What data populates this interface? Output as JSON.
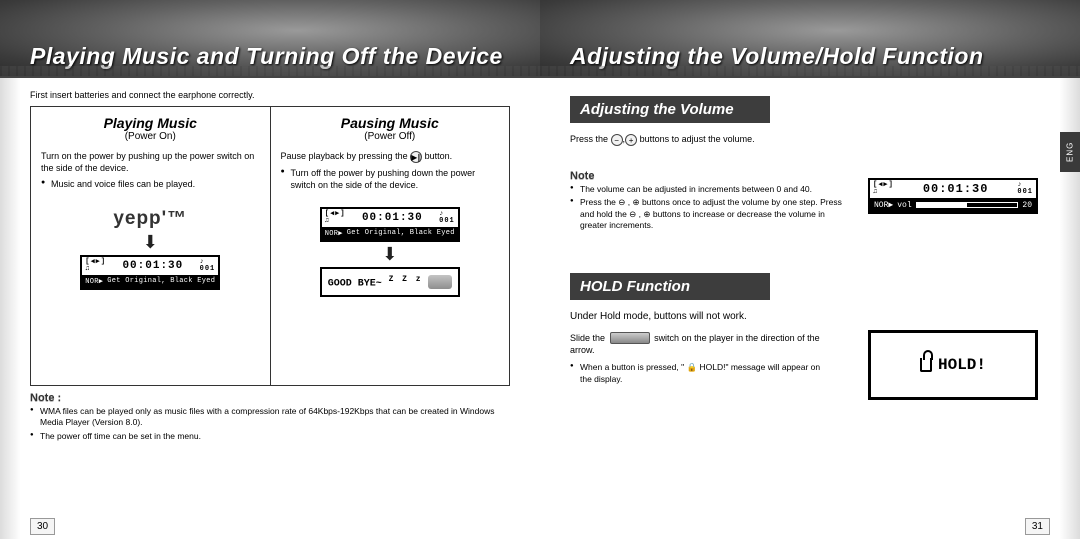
{
  "left": {
    "header_title": "Playing Music and Turning Off the Device",
    "intro": "First insert batteries and connect the earphone correctly.",
    "play": {
      "title": "Playing Music",
      "sub": "(Power On)",
      "body": "Turn on the power by pushing up the power switch on the side of the device.",
      "bullet": "Music and voice files can be played.",
      "brand": "yepp'™",
      "lcd_time": "00:01:30",
      "lcd_track_no": "001",
      "lcd_track": "Get Original, Black Eyed"
    },
    "pause": {
      "title": "Pausing Music",
      "sub": "(Power Off)",
      "body_a": "Pause playback by pressing the",
      "body_b": "button.",
      "bullet": "Turn off the power by pushing down the power switch on the side of the device.",
      "lcd_time": "00:01:30",
      "lcd_track_no": "001",
      "lcd_track": "Get Original, Black Eyed",
      "goodbye": "GOOD BYE~"
    },
    "note_label": "Note :",
    "notes": [
      "WMA files can be played only as music files with a compression rate of 64Kbps-192Kbps that can be created in Windows Media Player (Version 8.0).",
      "The power off time can be set in the menu."
    ],
    "page_no": "30"
  },
  "right": {
    "header_title": "Adjusting the Volume/Hold Function",
    "eng_tab": "ENG",
    "vol_section": "Adjusting the Volume",
    "vol_body_a": "Press the",
    "vol_body_b": "buttons  to adjust the volume.",
    "vol_lcd_time": "00:01:30",
    "vol_lcd_track_no": "001",
    "vol_label": "vol",
    "vol_value": "20",
    "note_label": "Note",
    "vol_notes": [
      "The volume can be adjusted in increments between 0 and 40.",
      "Press the ⊖ , ⊕ buttons once to adjust the volume by one step. Press and hold the ⊖ , ⊕ buttons to increase or decrease the volume in greater increments."
    ],
    "hold_section": "HOLD Function",
    "hold_intro": "Under Hold mode, buttons will not work.",
    "hold_body_a": "Slide the",
    "hold_body_b": "switch on the player in the direction of the arrow.",
    "hold_bullet_a": "When a button is pressed, \"",
    "hold_bullet_b": "HOLD!\" message will appear on the display.",
    "hold_display": "HOLD!",
    "page_no": "31"
  }
}
